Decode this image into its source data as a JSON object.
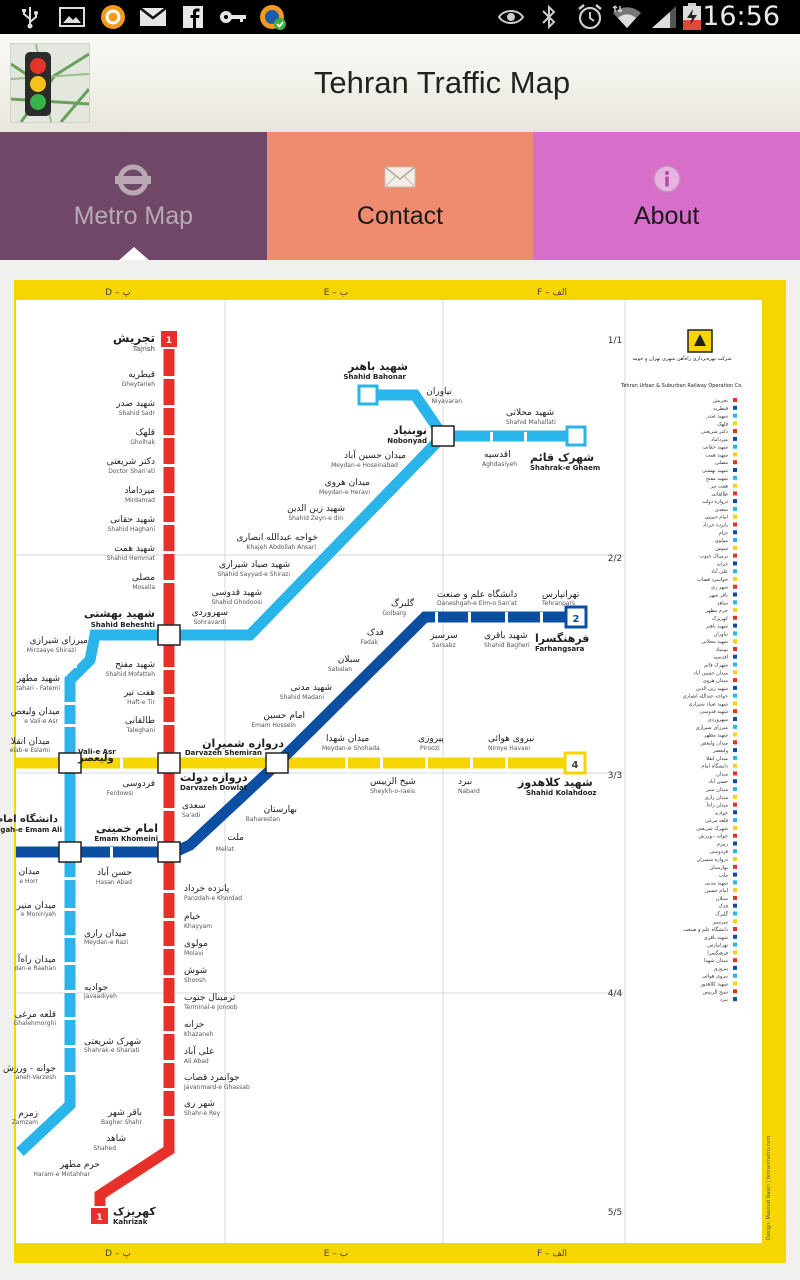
{
  "status_bar": {
    "time": "16:56",
    "icons_left": [
      "usb-icon",
      "image-icon",
      "app-notification-icon",
      "gmail-icon",
      "facebook-icon",
      "key-icon",
      "sync-icon"
    ],
    "icons_right": [
      "eye-icon",
      "bluetooth-icon",
      "alarm-icon",
      "wifi-icon",
      "signal-icon",
      "battery-icon"
    ]
  },
  "app": {
    "title": "Tehran Traffic Map"
  },
  "tabs": [
    {
      "label": "Metro Map",
      "icon": "metro-logo-icon",
      "selected": true,
      "color": "#6e4866"
    },
    {
      "label": "Contact",
      "icon": "envelope-icon",
      "selected": false,
      "color": "#ef8b6e"
    },
    {
      "label": "About",
      "icon": "info-icon",
      "selected": false,
      "color": "#d76fca"
    }
  ],
  "map": {
    "grid_top": [
      "D – پ",
      "E – ب",
      "F – الف"
    ],
    "grid_bottom": [
      "D – پ",
      "E – ب",
      "F – الف"
    ],
    "row_labels": [
      "1/1",
      "2/2",
      "3/3",
      "4/4",
      "5/5"
    ],
    "line_colors": {
      "line1": "#e8302a",
      "line2": "#0b4ea2",
      "line3": "#29b4ea",
      "line4": "#f6d500",
      "border": "#f6d500"
    },
    "line_badges": {
      "line1": "1",
      "line2": "2",
      "line4": "4"
    },
    "operator": {
      "name_fa": "شرکت بهره‌برداری راه‌آهن شهری تهران و حومه",
      "name_en": "Tehran Urban & Suburban Railway Operation Co."
    },
    "credit": "Design: Masoud Nasiri | tehranmetro.com",
    "stations": {
      "tajrish": {
        "fa": "تجریش",
        "en": "Tajrish"
      },
      "gheytarieh": {
        "fa": "قیطریه",
        "en": "Gheytarieh"
      },
      "shahid_sadr": {
        "fa": "شهید صدر",
        "en": "Shahid Sadr"
      },
      "gholhak": {
        "fa": "قلهک",
        "en": "Gholhak"
      },
      "doctor_shariati": {
        "fa": "دکتر شریعتی",
        "en": "Doctor Shari'ati"
      },
      "mirdamad": {
        "fa": "میرداماد",
        "en": "Mirdamad"
      },
      "shahid_haghani": {
        "fa": "شهید حقانی",
        "en": "Shahid Haghani"
      },
      "shahid_hemmat": {
        "fa": "شهید همت",
        "en": "Shahid Hemmat"
      },
      "mosalla": {
        "fa": "مصلی",
        "en": "Mosalla"
      },
      "shahid_beheshti": {
        "fa": "شهید بهشتی",
        "en": "Shahid Beheshti"
      },
      "shahid_mofatteh": {
        "fa": "شهید مفتح",
        "en": "Shahid Mofatteh"
      },
      "haft_e_tir": {
        "fa": "هفت تیر",
        "en": "Haft-e Tir"
      },
      "taleghani": {
        "fa": "طالقانی",
        "en": "Taleghani"
      },
      "darvazeh_dowlat": {
        "fa": "دروازه دولت",
        "en": "Darvazeh Dowlat"
      },
      "sa_adi": {
        "fa": "سعدی",
        "en": "Sa'adi"
      },
      "emam_khomeini": {
        "fa": "امام خمینی",
        "en": "Emam Khomeini"
      },
      "panzdah_e_khordad": {
        "fa": "پانزده خرداد",
        "en": "Panzdah-e Khordad"
      },
      "khayyam": {
        "fa": "خیام",
        "en": "Khayyam"
      },
      "molavi": {
        "fa": "مولوی",
        "en": "Molavi"
      },
      "shoosh": {
        "fa": "شوش",
        "en": "Shoosh"
      },
      "terminal_e_jonoob": {
        "fa": "ترمینال جنوب",
        "en": "Terminal-e Jonoob"
      },
      "khazaneh": {
        "fa": "خزانه",
        "en": "Khazaneh"
      },
      "ali_abad": {
        "fa": "علی آباد",
        "en": "Ali Abad"
      },
      "javanmard_e_ghassab": {
        "fa": "جوانمرد قصاب",
        "en": "Javanmard-e Ghassab"
      },
      "shahr_e_rey": {
        "fa": "شهر ری",
        "en": "Shahr-e Rey"
      },
      "bagher_shahr": {
        "fa": "باقر شهر",
        "en": "Bagher Shahr"
      },
      "shahed": {
        "fa": "شاهد",
        "en": "Shahed"
      },
      "haram_e_motahhar": {
        "fa": "حرم مطهر",
        "en": "Haram-e Motahhar"
      },
      "kahrizak": {
        "fa": "کهریزک",
        "en": "Kahrizak"
      },
      "shahid_bahonar": {
        "fa": "شهید باهنر",
        "en": "Shahid Bahonar"
      },
      "niyavaran": {
        "fa": "نیاوران",
        "en": "Niyavaran"
      },
      "shahid_mahallati": {
        "fa": "شهید محلاتی",
        "en": "Shahid Mahallati"
      },
      "nobonyad": {
        "fa": "نوبنیاد",
        "en": "Nobonyad"
      },
      "aghdasiyeh": {
        "fa": "اقدسیه",
        "en": "Aghdasiyeh"
      },
      "shahrak_e_ghaem": {
        "fa": "شهرک قائم",
        "en": "Shahrak-e Ghaem"
      },
      "meydan_e_hoseinabad": {
        "fa": "میدان حسین آباد",
        "en": "Meydan-e Hoseinabad"
      },
      "meydan_e_heravi": {
        "fa": "میدان هروی",
        "en": "Meydan-e Heravi"
      },
      "shahid_zeyn_e_din": {
        "fa": "شهید زین الدین",
        "en": "Shahid Zeyn-e din"
      },
      "khajeh_abdollah_ansari": {
        "fa": "خواجه عبدالله انصاری",
        "en": "Khajeh Abdollah Ansari"
      },
      "shahid_sayyad_e_shirazi": {
        "fa": "شهید صیاد شیرازی",
        "en": "Shahid Sayyad-e Shirazi"
      },
      "shahid_ghodoosi": {
        "fa": "شهید قدوسی",
        "en": "Shahid Ghodoosi"
      },
      "sohravardi": {
        "fa": "سهروردی",
        "en": "Sohravardi"
      },
      "mirzaye_shirazi": {
        "fa": "میرزای شیرازی",
        "en": "Mirzaaye Shirazi"
      },
      "shahid_motahari": {
        "fa": "شهید مطهر",
        "en": "tahari - Fatemi"
      },
      "meydan_e_vali_e_asr": {
        "fa": "میدان ولیعص",
        "en": "e Vali-e Asr"
      },
      "vali_e_asr": {
        "fa": "ولیعصر",
        "en": "Vali-e Asr"
      },
      "meydan_enghelab": {
        "fa": "میدان انقلا",
        "en": "elab-e Eslami"
      },
      "daneshgah_e_emam_ali": {
        "fa": "دانشگاه امام",
        "en": "Daneshgah-e Emam Ali"
      },
      "meydan_hor": {
        "fa": "میدان",
        "en": "e Horr"
      },
      "hasan_abad": {
        "fa": "حسن آباد",
        "en": "Hasan Abad"
      },
      "meydan_e_moniriyeh": {
        "fa": "میدان منیر",
        "en": "e Moniriyeh"
      },
      "meydan_e_razi": {
        "fa": "میدان رازی",
        "en": "Meydan-e Razi"
      },
      "meydan_e_rahahan": {
        "fa": "میدان راه‌آ",
        "en": "dan-e Raahan"
      },
      "javadiyeh": {
        "fa": "جوادیه",
        "en": "Javaadiyeh"
      },
      "ghalehmorghi": {
        "fa": "قلعه مرغی",
        "en": "Ghalehmorghi"
      },
      "shahrak_e_shariati": {
        "fa": "شهرک شریعتی",
        "en": "Shahrak-e Shariati"
      },
      "javaneh_varzesh": {
        "fa": "جوانه - ورزش",
        "en": "aneh-Varzesh"
      },
      "zamzam": {
        "fa": "زمزم",
        "en": "Zamzam"
      },
      "ferdowsi": {
        "fa": "فردوسی",
        "en": "Ferdowsi"
      },
      "darvazeh_shemiran": {
        "fa": "دروازه شمیران",
        "en": "Darvazeh Shemiran"
      },
      "baharestan": {
        "fa": "بهارستان",
        "en": "Baharestan"
      },
      "mellat": {
        "fa": "ملت",
        "en": "Mellat"
      },
      "shahid_madani": {
        "fa": "شهید مدنی",
        "en": "Shahid Madani"
      },
      "emam_hossein": {
        "fa": "امام حسین",
        "en": "Emam Hossein"
      },
      "sabalan": {
        "fa": "سبلان",
        "en": "Sabalan"
      },
      "fadak": {
        "fa": "فدک",
        "en": "Fadak"
      },
      "golbarg": {
        "fa": "گلبرگ",
        "en": "Golbarg"
      },
      "sarsabz": {
        "fa": "سرسبز",
        "en": "Sarsabz"
      },
      "daneshgah_e_elm_o_sanat": {
        "fa": "دانشگاه علم و صنعت",
        "en": "Daneshgah-e Elm-o San'at"
      },
      "shahid_bagheri": {
        "fa": "شهید باقری",
        "en": "Shahid Bagheri"
      },
      "tehranpars": {
        "fa": "تهرانپارس",
        "en": "Tehranpars"
      },
      "farhangsara": {
        "fa": "فرهنگسرا",
        "en": "Farhangsara"
      },
      "meydan_e_shohada": {
        "fa": "میدان شهدا",
        "en": "Meydan-e Shohada"
      },
      "pirooz": {
        "fa": "پیروزی",
        "en": "Piroozi"
      },
      "niroye_havaei": {
        "fa": "نیروی هوائی",
        "en": "Niroye Havaei"
      },
      "shahid_kolahdooz": {
        "fa": "شهید کلاهدوز",
        "en": "Shahid Kolahdooz"
      },
      "sheykh_o_raeis": {
        "fa": "شیخ الرییس",
        "en": "Sheykh-o-raeis"
      },
      "nabard": {
        "fa": "نبرد",
        "en": "Nabard"
      }
    }
  }
}
